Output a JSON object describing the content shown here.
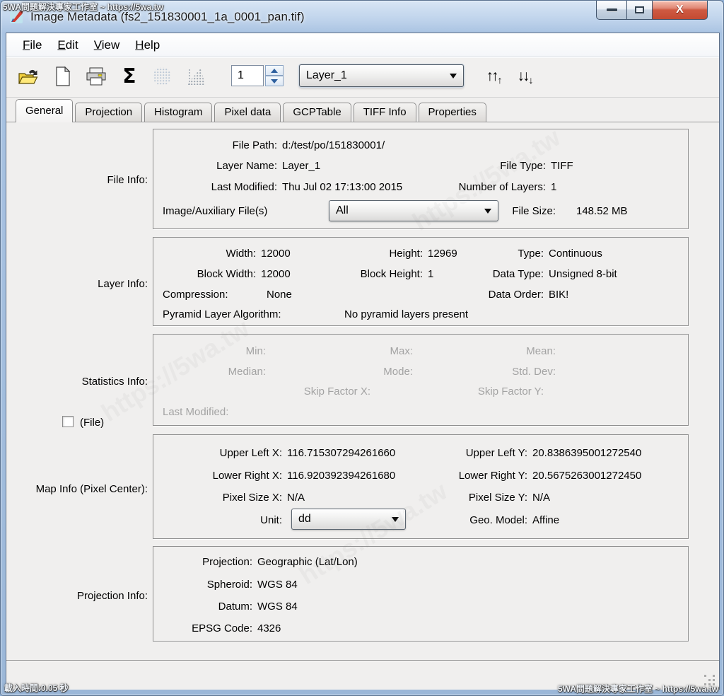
{
  "watermarks": {
    "top_left": "5WA問題解決專家工作室 ~ https://5wa.tw",
    "bottom_left": "載入時間:0.05 秒",
    "bottom_right": "5WA問題解決專家工作室 ~ https://5wa.tw",
    "diagonal": "https://5wa.tw"
  },
  "titlebar": {
    "title": "Image Metadata (fs2_151830001_1a_0001_pan.tif)",
    "close_glyph": "X"
  },
  "menu": {
    "items": [
      {
        "u": "F",
        "rest": "ile"
      },
      {
        "u": "E",
        "rest": "dit"
      },
      {
        "u": "V",
        "rest": "iew"
      },
      {
        "u": "H",
        "rest": "elp"
      }
    ]
  },
  "toolbar": {
    "sigma": "Σ",
    "layer_number": "1",
    "layer_combo_value": "Layer_1",
    "up_arrows": "↑↑",
    "up_small": "↑",
    "down_arrows": "↓↓",
    "down_small": "↓"
  },
  "tabs": {
    "active": "General",
    "items": [
      "General",
      "Projection",
      "Histogram",
      "Pixel data",
      "GCPTable",
      "TIFF Info",
      "Properties"
    ]
  },
  "general": {
    "file_info": {
      "section_label": "File Info:",
      "file_path": {
        "label": "File Path:",
        "value": "d:/test/po/151830001/"
      },
      "layer_name": {
        "label": "Layer Name:",
        "value": "Layer_1"
      },
      "file_type": {
        "label": "File Type:",
        "value": "TIFF"
      },
      "last_modified": {
        "label": "Last Modified:",
        "value": "Thu Jul 02 17:13:00 2015"
      },
      "number_of_layers": {
        "label": "Number of Layers:",
        "value": "1"
      },
      "aux_files_label": "Image/Auxiliary File(s)",
      "aux_files_value": "All",
      "file_size": {
        "label": "File Size:",
        "value": "148.52 MB"
      }
    },
    "layer_info": {
      "section_label": "Layer Info:",
      "width": {
        "label": "Width:",
        "value": "12000"
      },
      "height": {
        "label": "Height:",
        "value": "12969"
      },
      "type": {
        "label": "Type:",
        "value": "Continuous"
      },
      "block_width": {
        "label": "Block Width:",
        "value": "12000"
      },
      "block_height": {
        "label": "Block Height:",
        "value": "1"
      },
      "data_type": {
        "label": "Data Type:",
        "value": "Unsigned 8-bit"
      },
      "compression": {
        "label": "Compression:",
        "value": "None"
      },
      "data_order": {
        "label": "Data Order:",
        "value": "BIK!"
      },
      "pyramid": {
        "label": "Pyramid Layer Algorithm:",
        "value": "No pyramid layers present"
      }
    },
    "statistics_info": {
      "section_label": "Statistics Info:",
      "file_checkbox_label": "(File)",
      "min": "Min:",
      "max": "Max:",
      "mean": "Mean:",
      "median": "Median:",
      "mode": "Mode:",
      "std_dev": "Std. Dev:",
      "skip_x": "Skip Factor X:",
      "skip_y": "Skip Factor Y:",
      "last_modified": "Last Modified:"
    },
    "map_info": {
      "section_label": "Map Info (Pixel Center):",
      "upper_left_x": {
        "label": "Upper Left X:",
        "value": "116.715307294261660"
      },
      "upper_left_y": {
        "label": "Upper Left Y:",
        "value": "20.8386395001272540"
      },
      "lower_right_x": {
        "label": "Lower Right X:",
        "value": "116.920392394261680"
      },
      "lower_right_y": {
        "label": "Lower Right Y:",
        "value": "20.5675263001272450"
      },
      "pixel_size_x": {
        "label": "Pixel Size X:",
        "value": "N/A"
      },
      "pixel_size_y": {
        "label": "Pixel Size Y:",
        "value": "N/A"
      },
      "unit_label": "Unit:",
      "unit_value": "dd",
      "geo_model": {
        "label": "Geo. Model:",
        "value": "Affine"
      }
    },
    "projection_info": {
      "section_label": "Projection Info:",
      "projection": {
        "label": "Projection:",
        "value": "Geographic (Lat/Lon)"
      },
      "spheroid": {
        "label": "Spheroid:",
        "value": "WGS 84"
      },
      "datum": {
        "label": "Datum:",
        "value": "WGS 84"
      },
      "epsg": {
        "label": "EPSG Code:",
        "value": "4326"
      }
    }
  }
}
